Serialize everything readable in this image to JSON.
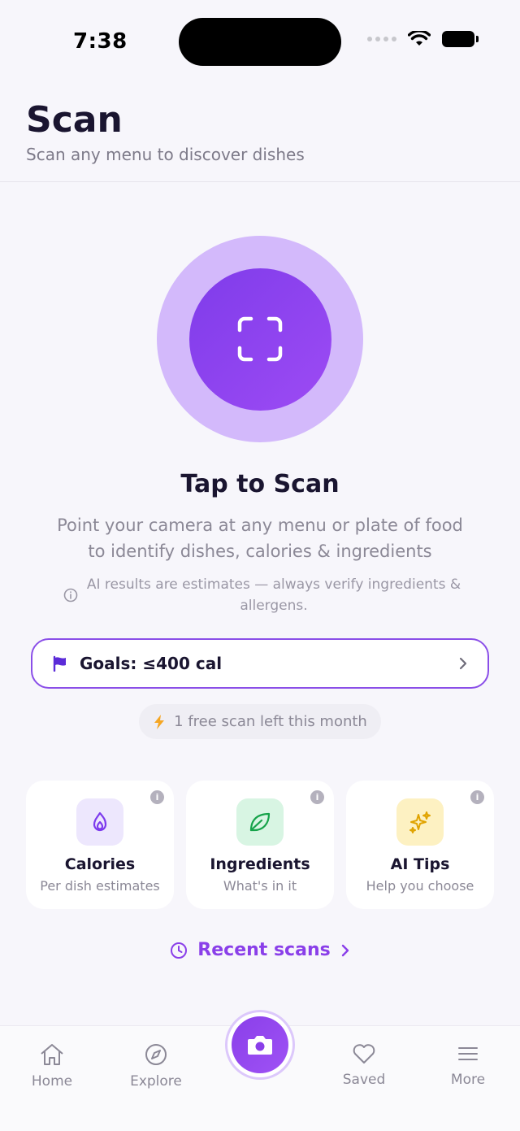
{
  "status_bar": {
    "time": "7:38"
  },
  "header": {
    "title": "Scan",
    "subtitle": "Scan any menu to discover dishes"
  },
  "scan": {
    "heading": "Tap to Scan",
    "description": "Point your camera at any menu or plate of food to identify dishes, calories & ingredients",
    "disclaimer": "AI results are estimates — always verify ingredients & allergens."
  },
  "goals": {
    "label": "Goals: ≤400 cal"
  },
  "free_scans": {
    "label": "1 free scan left this month"
  },
  "features": [
    {
      "title": "Calories",
      "subtitle": "Per dish estimates",
      "icon": "flame-icon",
      "bg": "#ede7fd",
      "color": "#7c3aed"
    },
    {
      "title": "Ingredients",
      "subtitle": "What's in it",
      "icon": "leaf-icon",
      "bg": "#d8f5e3",
      "color": "#16a34a"
    },
    {
      "title": "AI Tips",
      "subtitle": "Help you choose",
      "icon": "sparkles-icon",
      "bg": "#fdf1c2",
      "color": "#e0a300"
    }
  ],
  "recent": {
    "label": "Recent scans"
  },
  "tabbar": {
    "items": [
      {
        "label": "Home",
        "icon": "home-icon"
      },
      {
        "label": "Explore",
        "icon": "compass-icon"
      },
      {
        "label": "",
        "icon": "camera-icon"
      },
      {
        "label": "Saved",
        "icon": "heart-icon"
      },
      {
        "label": "More",
        "icon": "menu-icon"
      }
    ]
  },
  "colors": {
    "accent": "#8a3fe9",
    "accent_light": "#d3b9fb",
    "background": "#f7f6fb"
  }
}
